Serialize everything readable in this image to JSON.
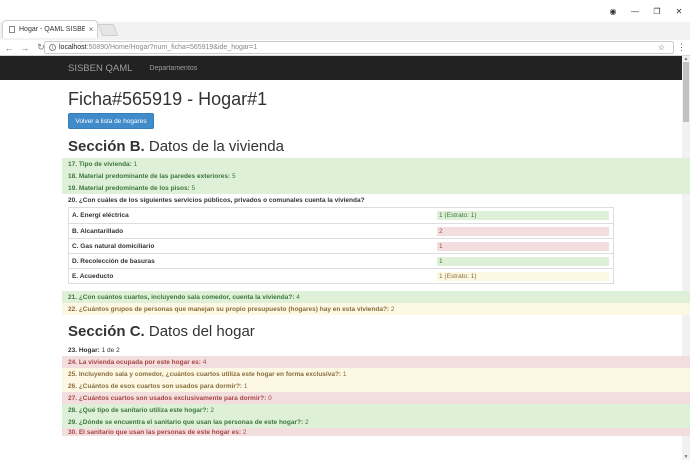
{
  "browser": {
    "tab_title": "Hogar - QAML SISBEN",
    "url_host": "localhost",
    "url_path": ":50890/Home/Hogar?num_ficha=565919&ide_hogar=1"
  },
  "navbar": {
    "brand": "SISBEN QAML",
    "link_departamentos": "Departamentos"
  },
  "page": {
    "title": "Ficha#565919 - Hogar#1",
    "back_button": "Volver a lista de hogares"
  },
  "seccion_b": {
    "label": "Sección B.",
    "title": "Datos de la vivienda",
    "q17": {
      "q": "17. Tipo de vivienda:",
      "a": "1",
      "status": "ok"
    },
    "q18": {
      "q": "18. Material predominante de las paredes exteriores:",
      "a": "5",
      "status": "ok"
    },
    "q19": {
      "q": "19. Material predominante de los pisos:",
      "a": "5",
      "status": "ok"
    },
    "q20": {
      "q": "20. ¿Con cuáles de los siguientes servicios públicos, privados o comunales cuenta la vivienda?",
      "a": ""
    },
    "services": [
      {
        "label": "A. Energí eléctrica",
        "value": "1 (Estrato: 1)",
        "status": "ok"
      },
      {
        "label": "B. Alcantarillado",
        "value": "2",
        "status": "bad"
      },
      {
        "label": "C. Gas natural domiciliario",
        "value": "1",
        "status": "bad"
      },
      {
        "label": "D. Recolección de basuras",
        "value": "1",
        "status": "ok"
      },
      {
        "label": "E. Acueducto",
        "value": "1 (Estrato: 1)",
        "status": "warn"
      }
    ],
    "q21": {
      "q": "21. ¿Con cuántos cuartos, incluyendo sala comedor, cuenta la vivienda?:",
      "a": "4",
      "status": "ok"
    },
    "q22": {
      "q": "22. ¿Cuántos grupos de personas que manejan su propio presupuesto (hogares) hay en esta vivienda?:",
      "a": "2",
      "status": "warn"
    }
  },
  "seccion_c": {
    "label": "Sección C.",
    "title": "Datos del hogar",
    "q23": {
      "q": "23. Hogar:",
      "a": "1 de 2"
    },
    "q24": {
      "q": "24. La vivienda ocupada por este hogar es:",
      "a": "4",
      "status": "bad"
    },
    "q25": {
      "q": "25. Incluyendo sala y comedor, ¿cuántos cuartos utiliza este hogar en forma exclusiva?:",
      "a": "1",
      "status": "warn"
    },
    "q26": {
      "q": "26. ¿Cuántos de esos cuartos son usados para dormir?:",
      "a": "1",
      "status": "warn"
    },
    "q27": {
      "q": "27. ¿Cuántos cuartos son usados exclusivamente para dormir?:",
      "a": "0",
      "status": "bad"
    },
    "q28": {
      "q": "28. ¿Qué tipo de sanitario utiliza este hogar?:",
      "a": "2",
      "status": "ok"
    },
    "q29": {
      "q": "29. ¿Dónde se encuentra el sanitario que usan las personas de este hogar?:",
      "a": "2",
      "status": "ok"
    },
    "q30": {
      "q": "30. El sanitario que usan las personas de este hogar es:",
      "a": "2",
      "status": "bad"
    }
  },
  "colors": {
    "ok_bg": "#dff0d8",
    "bad_bg": "#f2dede",
    "warn_bg": "#fcf8e3",
    "navbar_bg": "#222222",
    "button_bg": "#428bca"
  }
}
